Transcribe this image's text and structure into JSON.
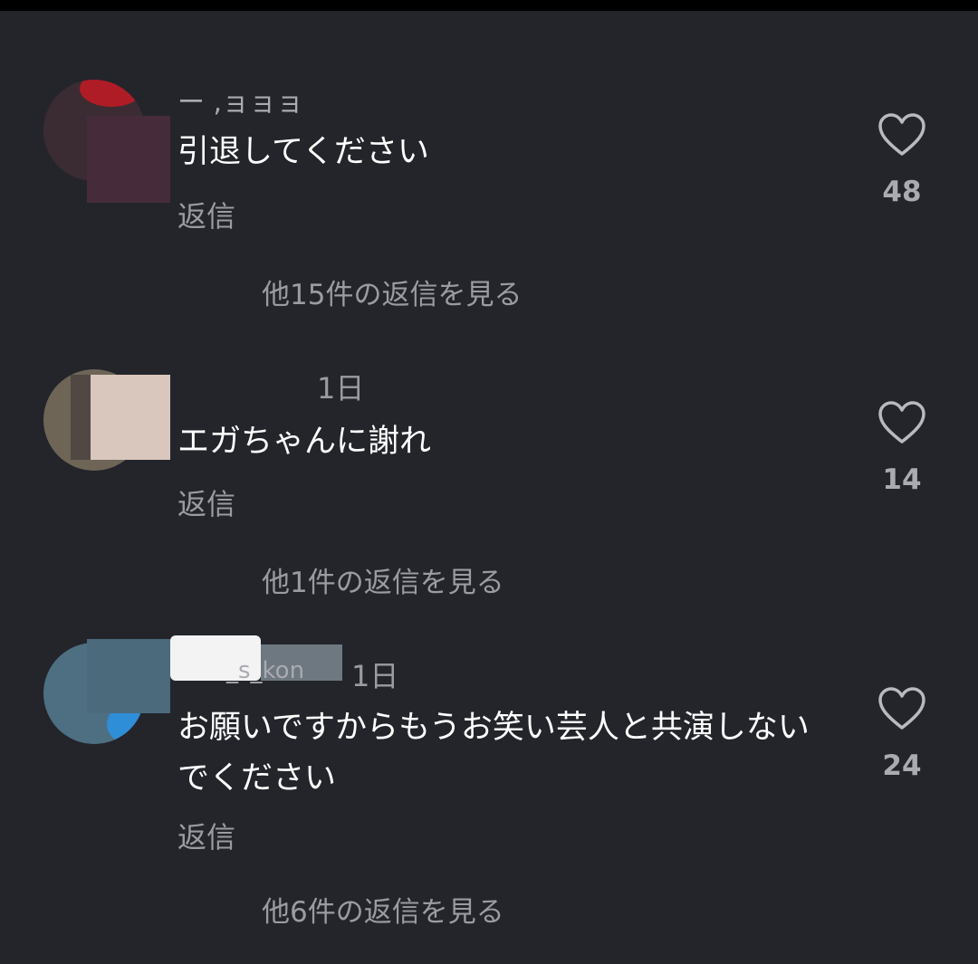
{
  "colors": {
    "background": "#23252b",
    "text": "#ffffff",
    "muted": "#9a9ca1"
  },
  "comments": [
    {
      "username": "ー ,ョョョ",
      "time": "",
      "text": "引退してください",
      "reply_label": "返信",
      "likes": "48",
      "more_replies": "他15件の返信を見る",
      "icon": "heart-outline-icon"
    },
    {
      "username": "",
      "time": "1日",
      "text": "エガちゃんに謝れ",
      "reply_label": "返信",
      "likes": "14",
      "more_replies": "他1件の返信を見る",
      "icon": "heart-outline-icon"
    },
    {
      "username": "_s_kon",
      "time": "1日",
      "text": "お願いですからもうお笑い芸人と共演しないでください",
      "reply_label": "返信",
      "likes": "24",
      "more_replies": "他6件の返信を見る",
      "icon": "heart-outline-icon"
    }
  ]
}
